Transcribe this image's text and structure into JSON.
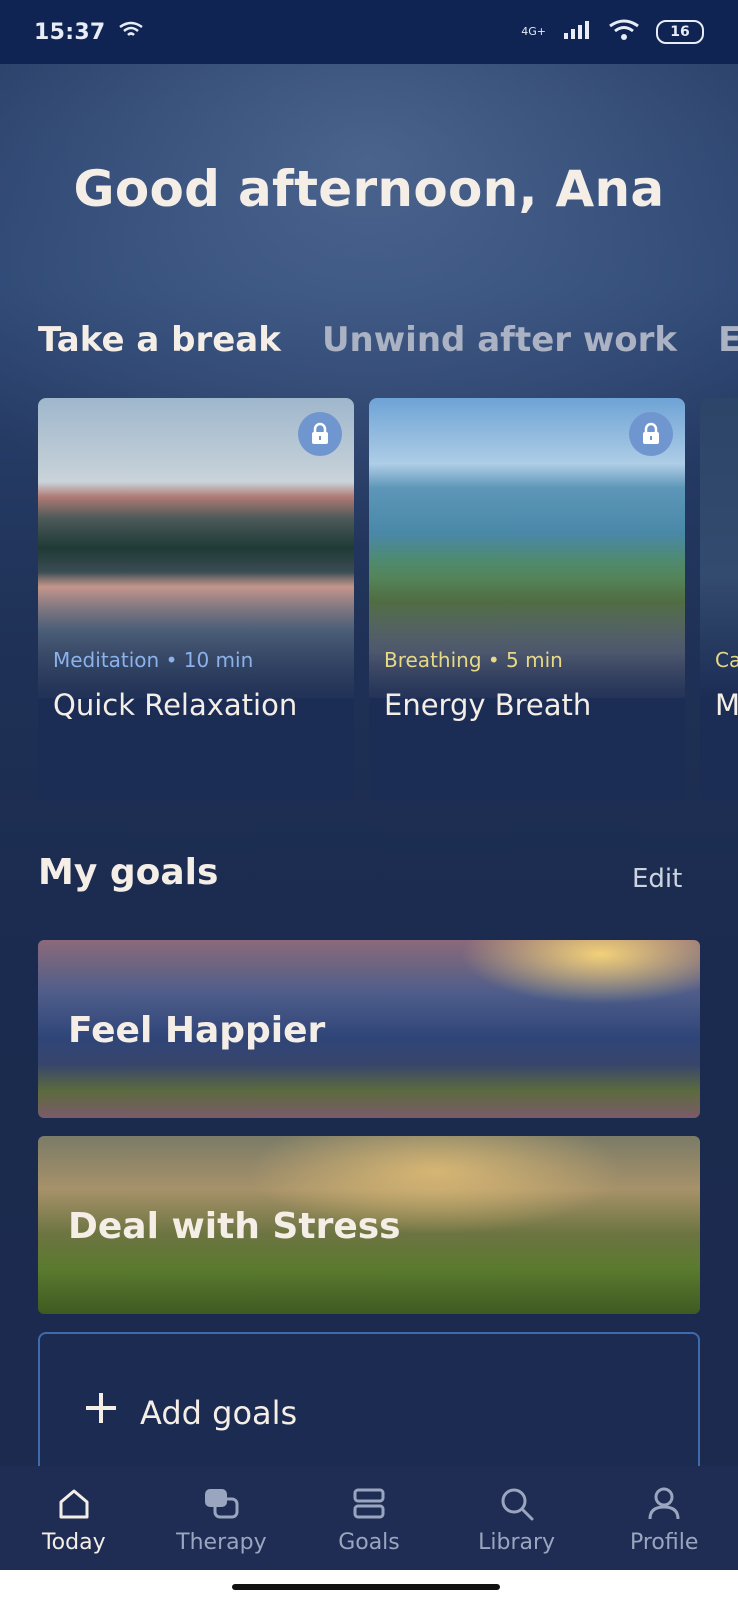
{
  "status_bar": {
    "time": "15:37",
    "network": "4G+",
    "battery": "16"
  },
  "header": {
    "greeting": "Good afternoon, Ana"
  },
  "tabs": [
    {
      "label": "Take a break"
    },
    {
      "label": "Unwind after work"
    },
    {
      "label": "Elevate y"
    }
  ],
  "cards": [
    {
      "category": "Meditation • 10 min",
      "title": "Quick Relaxation",
      "locked": true,
      "accent": "#8bb2ea",
      "image_icon": "mountain-lake-image"
    },
    {
      "category": "Breathing • 5 min",
      "title": "Energy Breath",
      "locked": true,
      "accent": "#e7d985",
      "image_icon": "ocean-coast-image"
    },
    {
      "category": "Ca",
      "title": "M",
      "accent": "#e7d985",
      "image_icon": "night-sky-image"
    }
  ],
  "goals_section": {
    "title": "My goals",
    "edit_label": "Edit",
    "items": [
      {
        "label": "Feel Happier"
      },
      {
        "label": "Deal with Stress"
      }
    ],
    "add_label": "Add goals"
  },
  "bottom_nav": [
    {
      "label": "Today",
      "icon": "home-icon",
      "active": true
    },
    {
      "label": "Therapy",
      "icon": "chat-bubbles-icon"
    },
    {
      "label": "Goals",
      "icon": "goals-icon"
    },
    {
      "label": "Library",
      "icon": "search-icon"
    },
    {
      "label": "Profile",
      "icon": "profile-icon"
    }
  ]
}
